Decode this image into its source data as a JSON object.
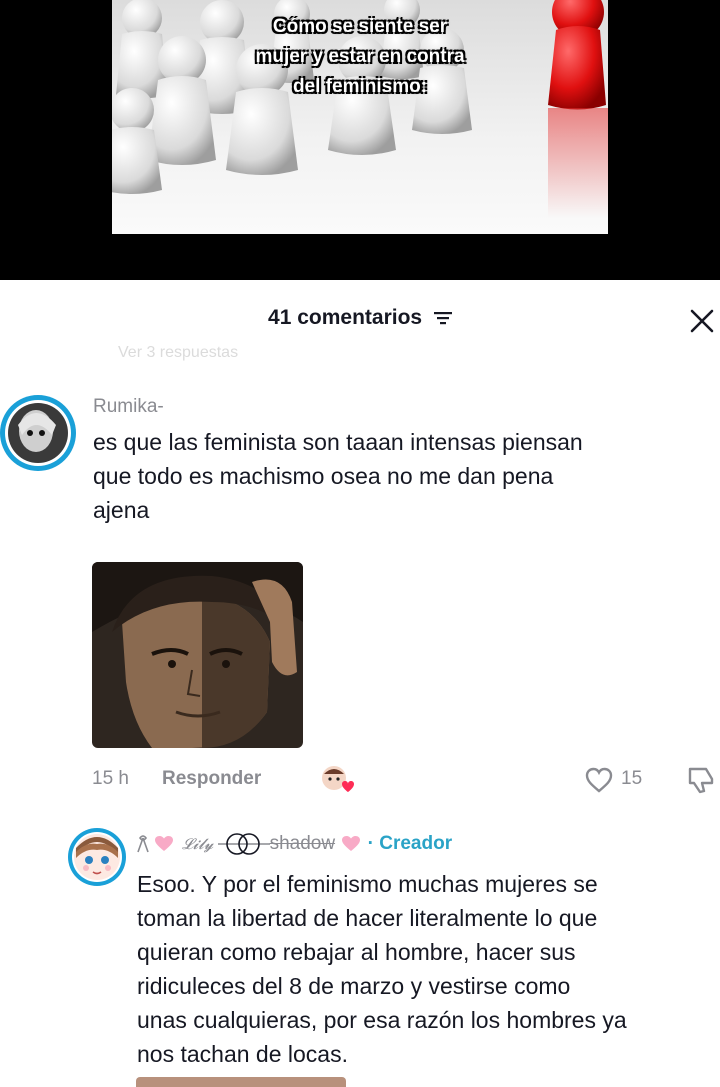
{
  "video": {
    "overlay_lines": [
      "Cómo se siente ser",
      "mujer y estar en contra",
      "del feminismo:"
    ]
  },
  "comments_panel": {
    "title": "41 comentarios",
    "faded_text": "Ver 3 respuestas"
  },
  "comment1": {
    "username": "Rumika-",
    "text_lines": [
      "es que las feminista son taaan intensas piensan",
      "que todo es machismo osea no me dan pena",
      "ajena"
    ],
    "time": "15 h",
    "reply_label": "Responder",
    "like_count": "15"
  },
  "comment2": {
    "username": "shadow",
    "creator_label": "· Creador",
    "text_lines": [
      "Esoo. Y por el feminismo muchas mujeres se",
      "toman la libertad de hacer literalmente lo que",
      "quieran como rebajar al hombre, hacer sus",
      "ridiculeces del 8 de marzo y vestirse como",
      "unas cualquieras, por esa razón los hombres ya",
      "nos tachan de locas."
    ]
  },
  "colors": {
    "creator": "#2aa3c7",
    "muted": "#8a8b91",
    "text": "#161823",
    "like_heart": "#fe2c55"
  },
  "icons": [
    "filter-icon",
    "close-icon",
    "heart-outline-icon",
    "dislike-icon",
    "sticker-icon"
  ]
}
